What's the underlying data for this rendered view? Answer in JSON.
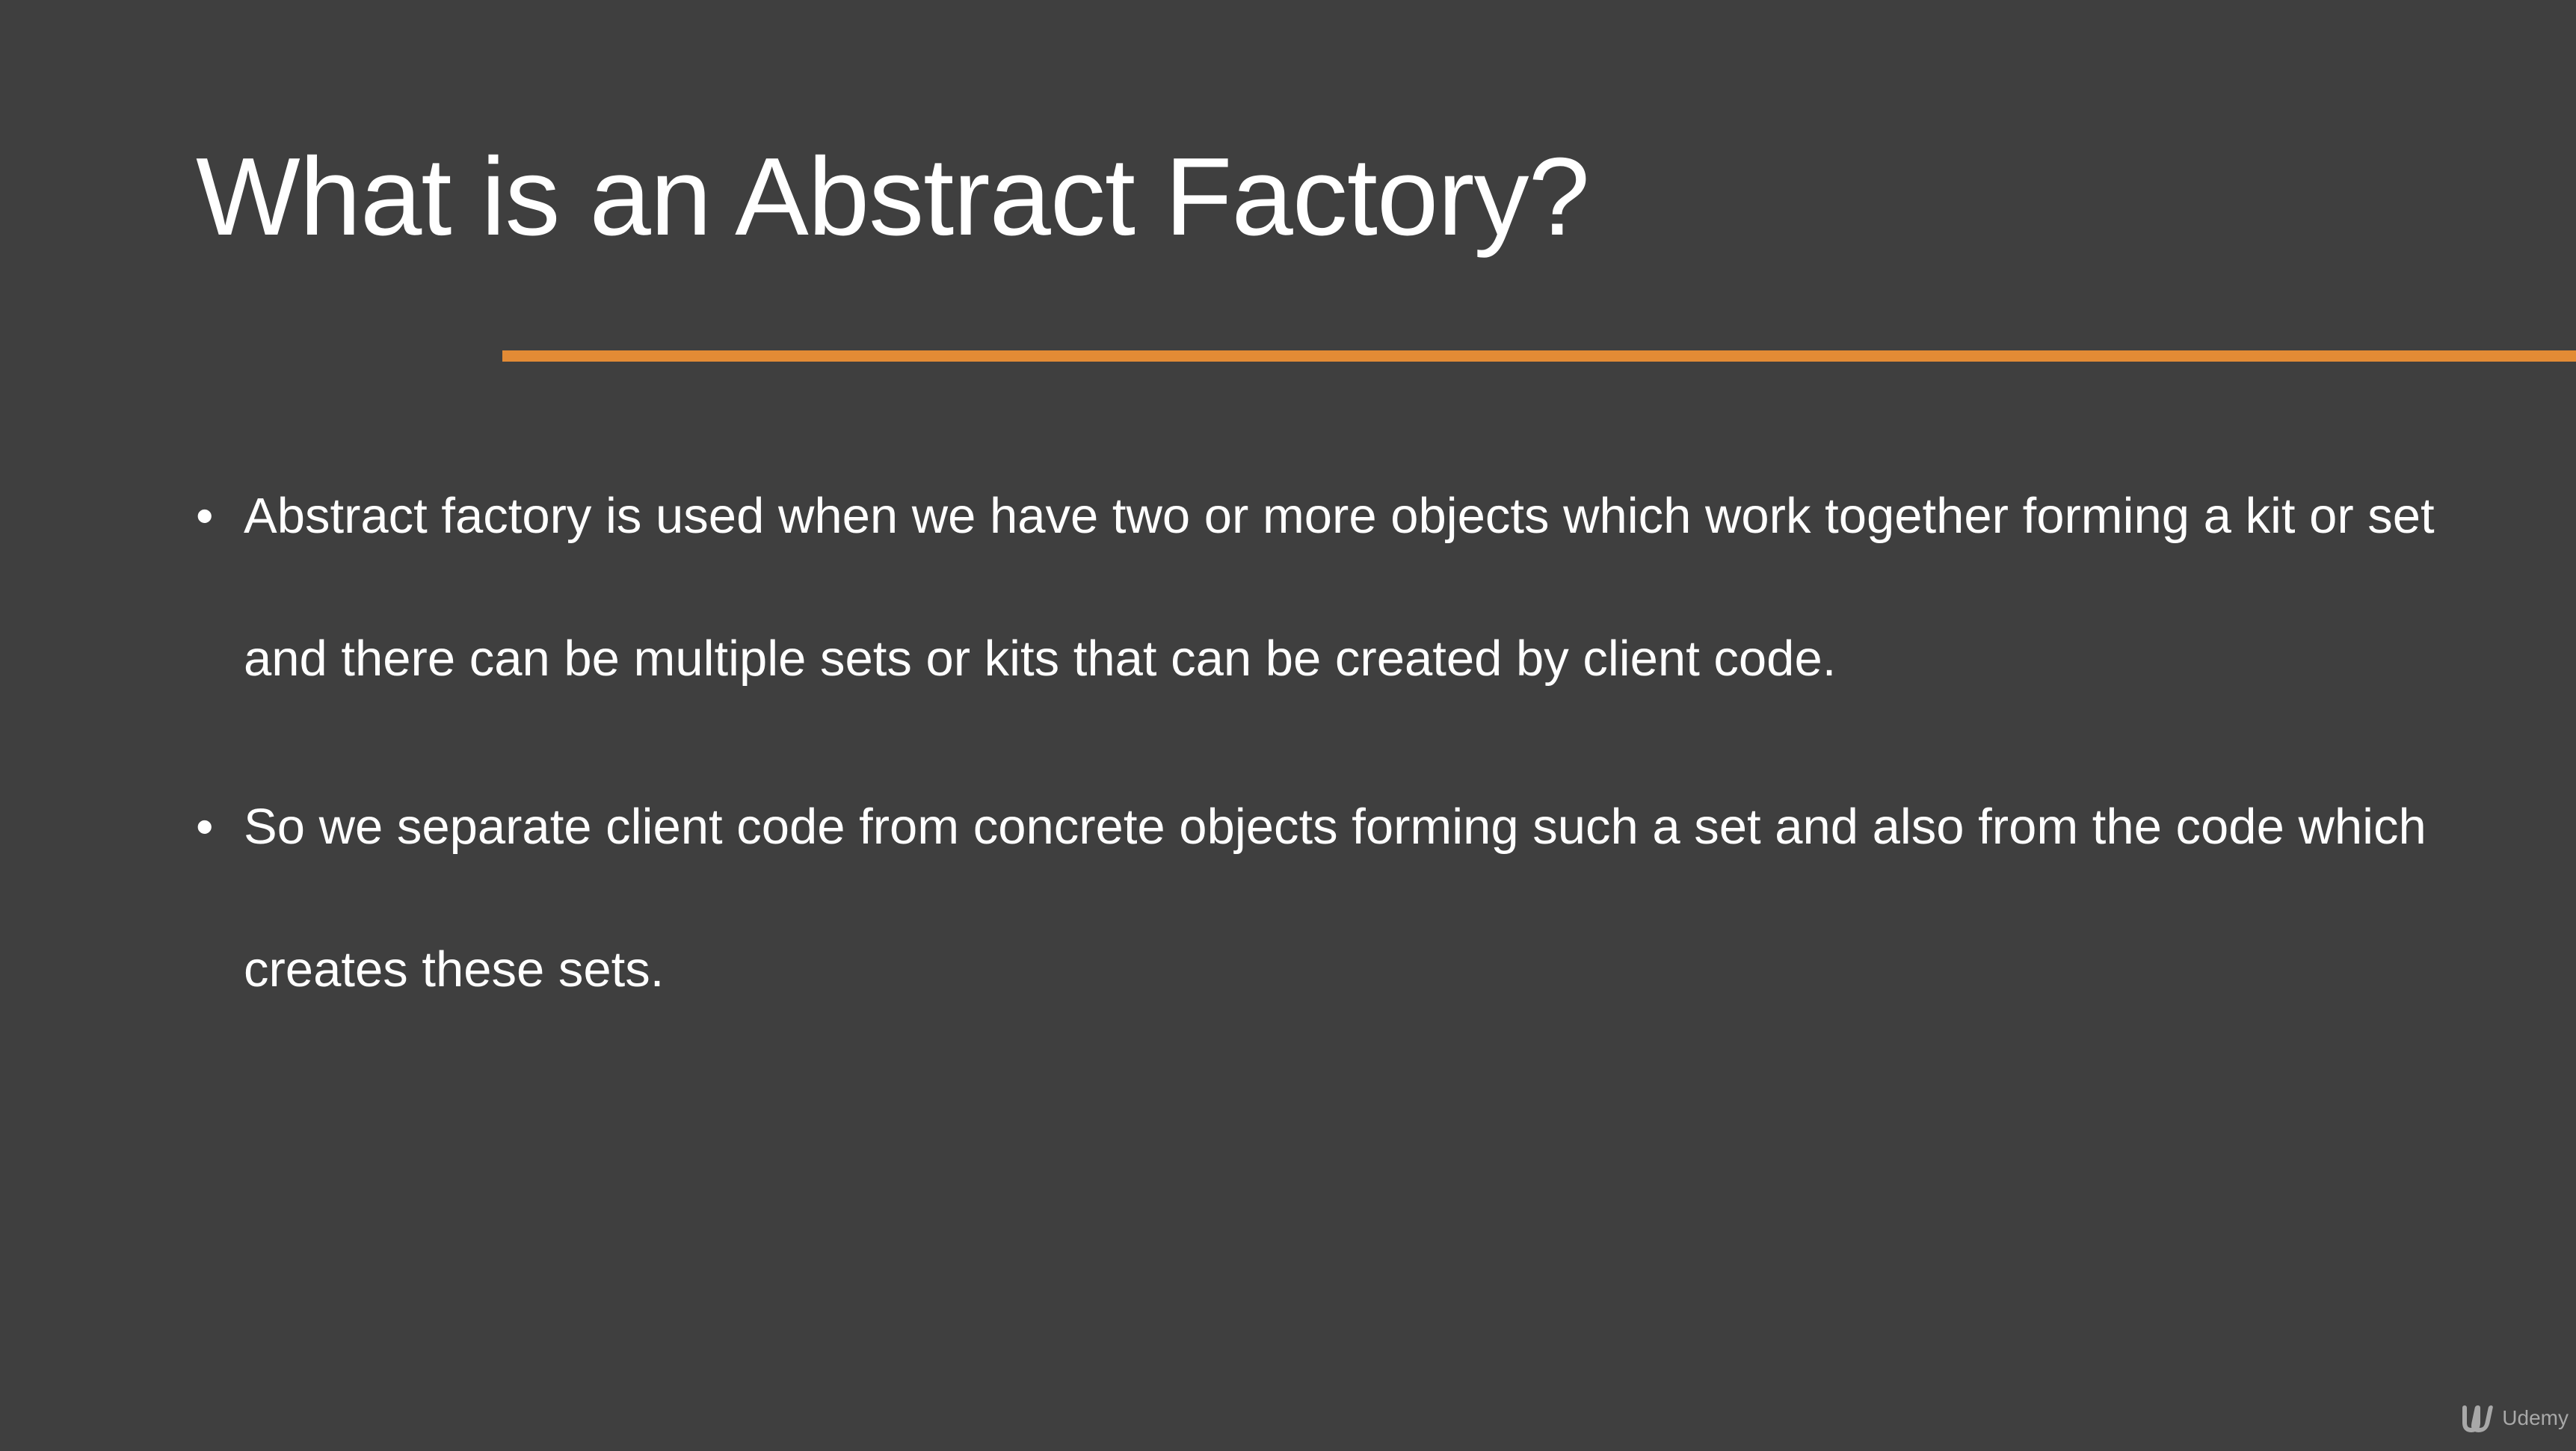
{
  "slide": {
    "title": "What is an Abstract Factory?",
    "accent_color": "#e38b35",
    "background_color": "#3f3f3f",
    "bullets": [
      {
        "text": "Abstract factory is used when we have two or more objects which work together forming a kit or set and there can be multiple sets or kits that can be created by client code."
      },
      {
        "text": "So we separate client code from concrete objects forming such a set and also from the code which creates these sets."
      }
    ],
    "bullet_glyph": "•"
  },
  "watermark": {
    "brand": "Udemy",
    "icon": "udemy-logo-icon"
  }
}
